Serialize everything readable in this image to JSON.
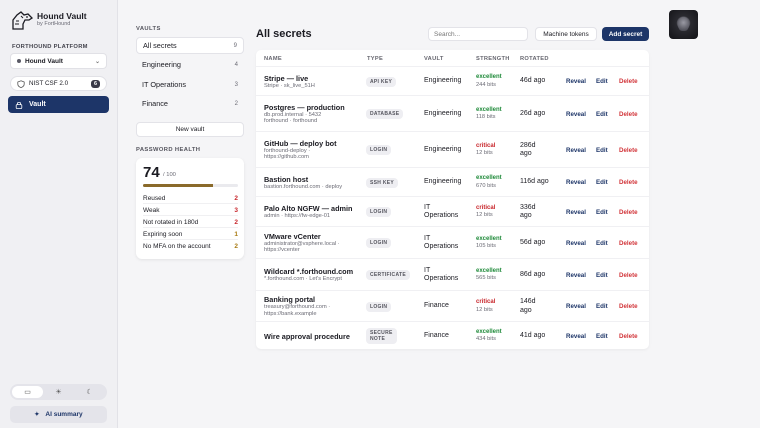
{
  "brand": {
    "name": "Hound Vault",
    "sub": "by FortHound"
  },
  "sidebar": {
    "org_label": "FORTHOUND PLATFORM",
    "vault_select": "Hound Vault",
    "framework": {
      "label": "NIST CSF 2.0",
      "badge": "6"
    },
    "nav_vault": "Vault",
    "theme_options": [
      "monitor-icon",
      "sun-icon",
      "moon-icon"
    ],
    "ai_summary": "AI summary"
  },
  "vaults": {
    "label": "VAULTS",
    "items": [
      {
        "name": "All secrets",
        "count": "9"
      },
      {
        "name": "Engineering",
        "count": "4"
      },
      {
        "name": "IT Operations",
        "count": "3"
      },
      {
        "name": "Finance",
        "count": "2"
      }
    ],
    "new_vault": "New vault"
  },
  "health": {
    "label": "PASSWORD HEALTH",
    "score": "74",
    "score_max": "/ 100",
    "score_fraction": 0.74,
    "rows": [
      {
        "label": "Reused",
        "value": "2",
        "color": "#c8262b"
      },
      {
        "label": "Weak",
        "value": "3",
        "color": "#c8262b"
      },
      {
        "label": "Not rotated in 180d",
        "value": "2",
        "color": "#c8262b"
      },
      {
        "label": "Expiring soon",
        "value": "1",
        "color": "#a87a12"
      },
      {
        "label": "No MFA on the account",
        "value": "2",
        "color": "#a87a12"
      }
    ]
  },
  "main": {
    "title": "All secrets",
    "search_placeholder": "Search...",
    "tokens_button": "Machine tokens",
    "add_button": "Add secret",
    "columns": [
      "NAME",
      "TYPE",
      "VAULT",
      "STRENGTH",
      "ROTATED"
    ],
    "actions": {
      "reveal": "Reveal",
      "edit": "Edit",
      "delete": "Delete"
    },
    "rows": [
      {
        "name": "Stripe — live",
        "sub": [
          "Stripe · sk_live_51H"
        ],
        "type": "API KEY",
        "vault": [
          "Engineering"
        ],
        "strength": "excellent",
        "bits": "244 bits",
        "rotated": [
          "46d ago"
        ]
      },
      {
        "name": "Postgres — production",
        "sub": [
          "db.prod.internal · 5432",
          "forthound · forthound"
        ],
        "type": "DATABASE",
        "vault": [
          "Engineering"
        ],
        "strength": "excellent",
        "bits": "118 bits",
        "rotated": [
          "26d ago"
        ]
      },
      {
        "name": "GitHub — deploy bot",
        "sub": [
          "forthound-deploy ·",
          "https://github.com"
        ],
        "type": "LOGIN",
        "vault": [
          "Engineering"
        ],
        "strength": "critical",
        "bits": "12 bits",
        "rotated": [
          "286d",
          "ago"
        ]
      },
      {
        "name": "Bastion host",
        "sub": [
          "bastion.forthound.com · deploy"
        ],
        "type": "SSH KEY",
        "vault": [
          "Engineering"
        ],
        "strength": "excellent",
        "bits": "670 bits",
        "rotated": [
          "116d ago"
        ]
      },
      {
        "name": "Palo Alto NGFW — admin",
        "sub": [
          "admin · https://fw-edge-01"
        ],
        "type": "LOGIN",
        "vault": [
          "IT",
          "Operations"
        ],
        "strength": "critical",
        "bits": "12 bits",
        "rotated": [
          "336d",
          "ago"
        ]
      },
      {
        "name": "VMware vCenter",
        "sub": [
          "administrator@vsphere.local ·",
          "https://vcenter"
        ],
        "type": "LOGIN",
        "vault": [
          "IT",
          "Operations"
        ],
        "strength": "excellent",
        "bits": "105 bits",
        "rotated": [
          "56d ago"
        ]
      },
      {
        "name": "Wildcard *.forthound.com",
        "sub": [
          "*.forthound.com · Let's Encrypt"
        ],
        "type": "CERTIFICATE",
        "vault": [
          "IT",
          "Operations"
        ],
        "strength": "excellent",
        "bits": "565 bits",
        "rotated": [
          "86d ago"
        ]
      },
      {
        "name": "Banking portal",
        "sub": [
          "treasury@forthound.com ·",
          "https://bank.example"
        ],
        "type": "LOGIN",
        "vault": [
          "Finance"
        ],
        "strength": "critical",
        "bits": "12 bits",
        "rotated": [
          "146d",
          "ago"
        ]
      },
      {
        "name": "Wire approval procedure",
        "sub": [],
        "type": [
          "SECURE",
          "NOTE"
        ],
        "vault": [
          "Finance"
        ],
        "strength": "excellent",
        "bits": "434 bits",
        "rotated": [
          "41d ago"
        ]
      }
    ]
  }
}
